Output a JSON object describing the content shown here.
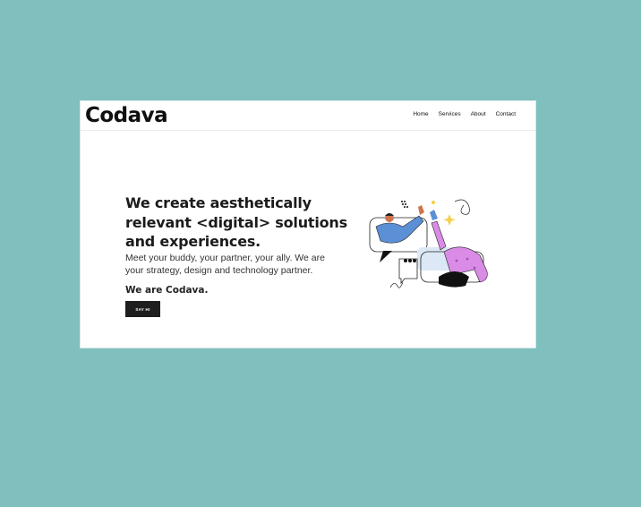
{
  "header": {
    "logo": "Codava",
    "nav": [
      {
        "label": "Home"
      },
      {
        "label": "Services"
      },
      {
        "label": "About"
      },
      {
        "label": "Contact"
      }
    ]
  },
  "hero": {
    "title_lines": [
      "We create aesthetically",
      "relevant <digital> solutions",
      "and experiences."
    ],
    "subtitle_lines": [
      "Meet your buddy, your partner, your ally. We are",
      "your strategy, design and technology partner."
    ],
    "tagline": "We are Codava.",
    "cta_label": "SAY HI"
  },
  "illustration": {
    "icon": "high-five-illustration",
    "colors": {
      "person_left_shirt": "#5b8fd6",
      "person_right_shirt": "#d98be6",
      "accent_star": "#f2d14b",
      "bubble_fill": "#dde8f6"
    }
  },
  "colors": {
    "background": "#7fc0bf",
    "card": "#ffffff",
    "button": "#1f1f1f"
  }
}
